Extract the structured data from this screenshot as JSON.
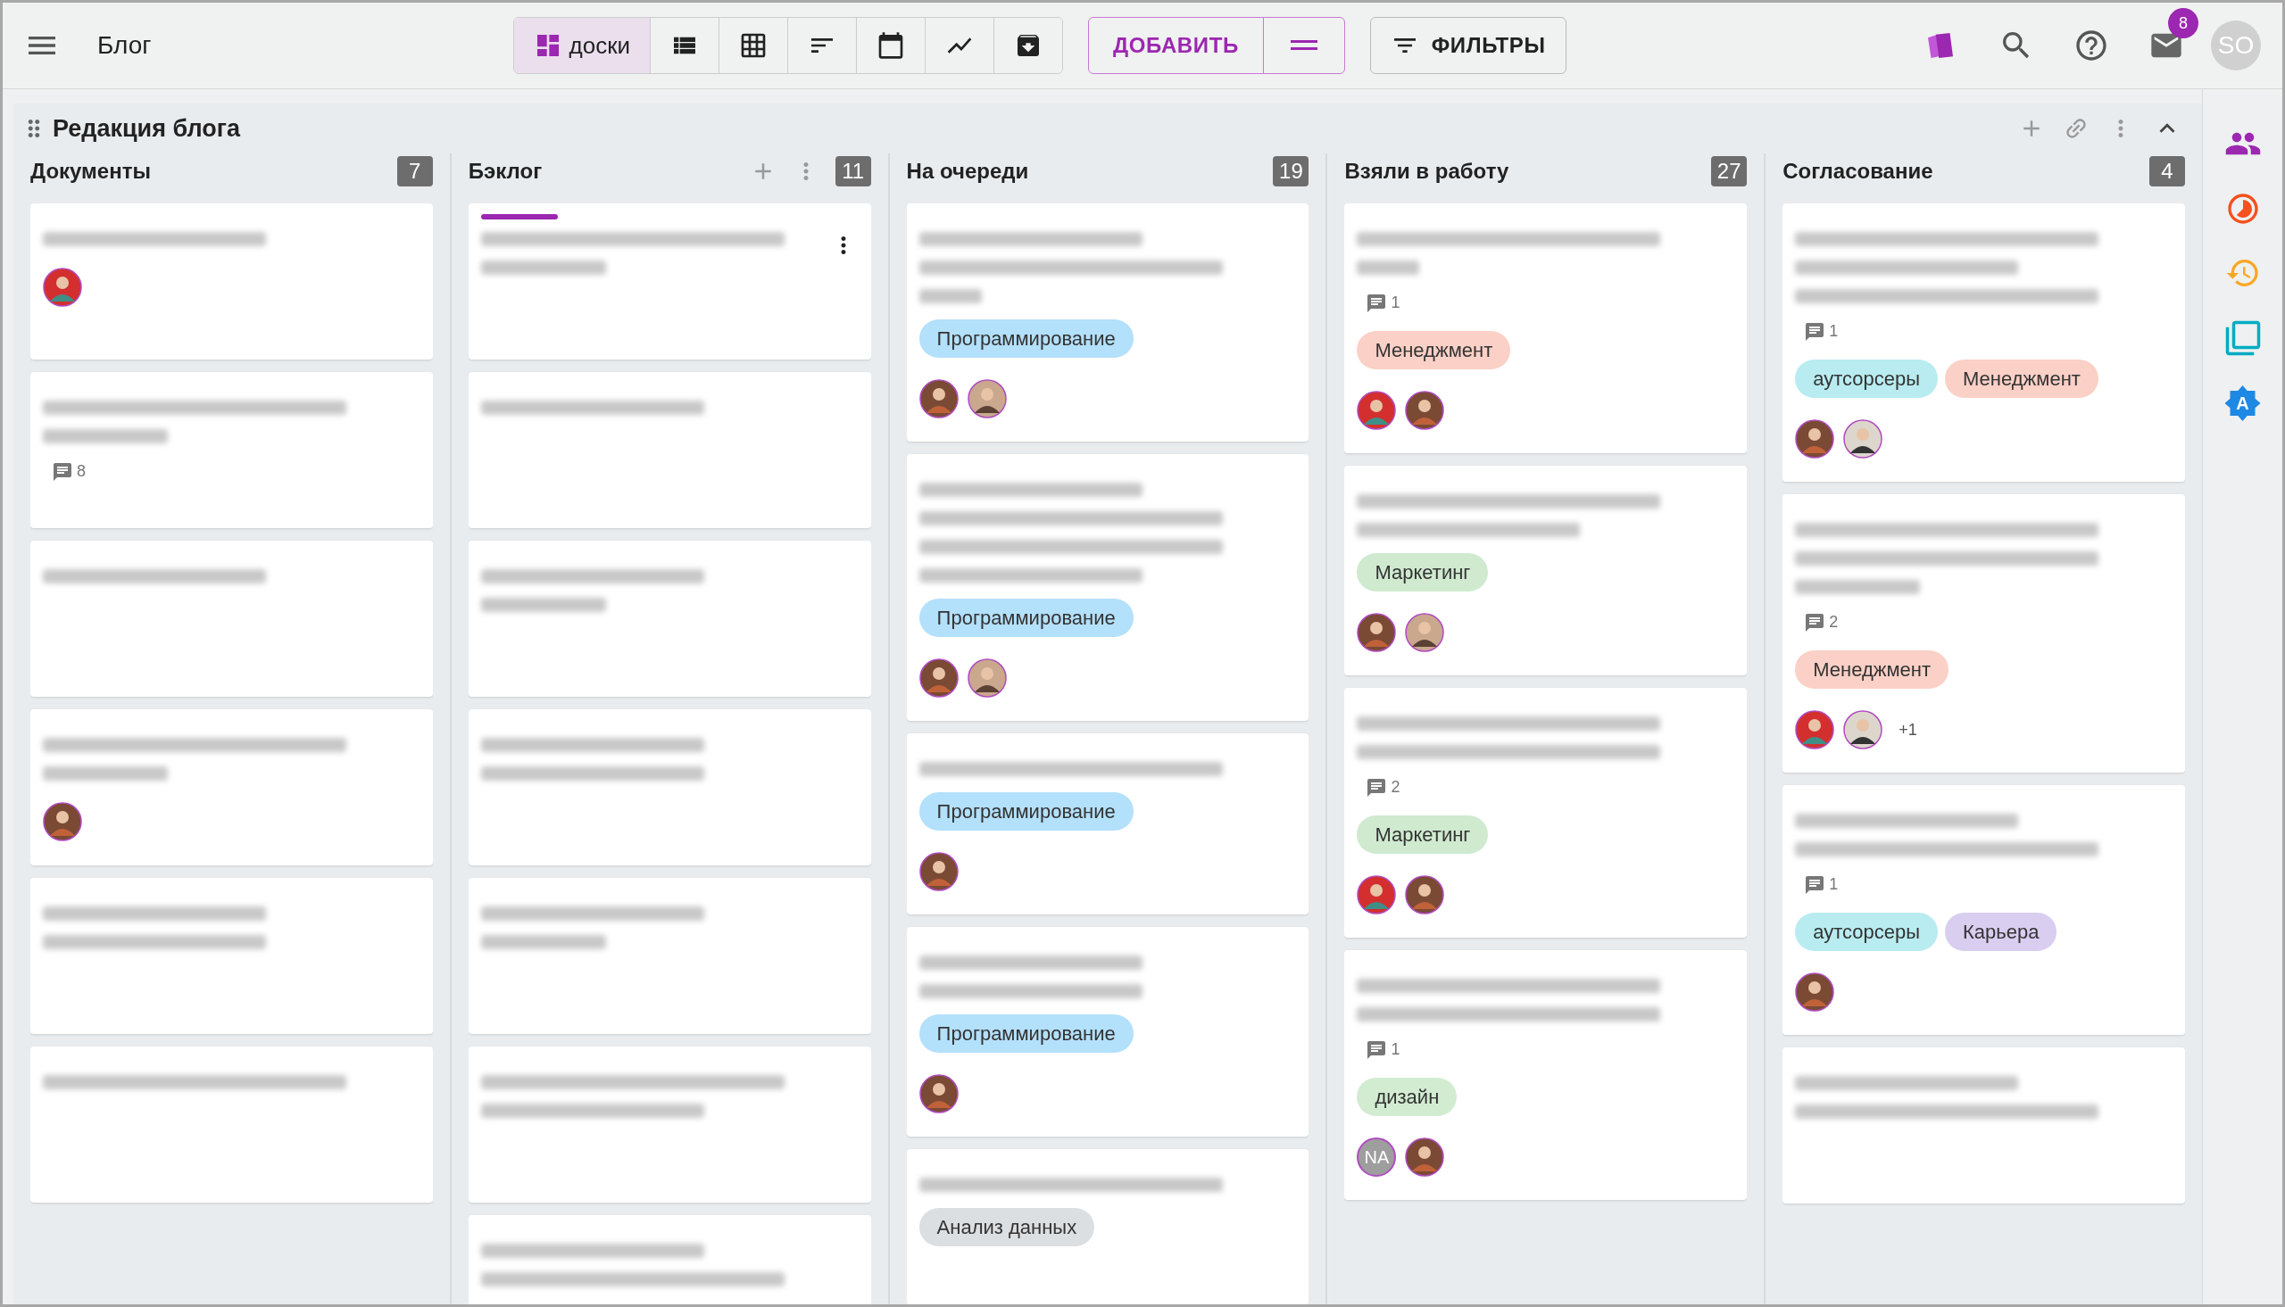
{
  "app_bar": {
    "title": "Блог",
    "views": [
      {
        "kind": "boards",
        "label": "доски",
        "selected": true
      },
      {
        "kind": "list",
        "selected": false
      },
      {
        "kind": "table",
        "selected": false
      },
      {
        "kind": "gantt",
        "selected": false
      },
      {
        "kind": "calendar",
        "selected": false
      },
      {
        "kind": "chart",
        "selected": false
      },
      {
        "kind": "archive",
        "selected": false
      }
    ],
    "add_button": "ДОБАВИТЬ",
    "filters_button": "ФИЛЬТРЫ",
    "mail_badge": "8",
    "user_initials": "SO"
  },
  "board": {
    "title": "Редакция блога",
    "columns": [
      {
        "title": "Документы",
        "count": "7",
        "cards": [
          {
            "lines": [
              {
                "kind": "medium"
              }
            ],
            "avatars": [
              {
                "kind": "red"
              }
            ]
          },
          {
            "lines": [
              {
                "kind": "long"
              },
              {
                "kind": "short"
              }
            ],
            "comments": "8"
          },
          {
            "lines": [
              {
                "kind": "medium"
              }
            ]
          },
          {
            "lines": [
              {
                "kind": "long"
              },
              {
                "kind": "short"
              }
            ],
            "avatars": [
              {
                "kind": "brown"
              }
            ]
          },
          {
            "lines": [
              {
                "kind": "medium"
              },
              {
                "kind": "medium"
              }
            ]
          },
          {
            "lines": [
              {
                "kind": "long"
              }
            ]
          }
        ]
      },
      {
        "title": "Бэклог",
        "count": "11",
        "actions": true,
        "cards": [
          {
            "progress": true,
            "menu": true,
            "lines": [
              {
                "kind": "long"
              },
              {
                "kind": "short"
              }
            ]
          },
          {
            "lines": [
              {
                "kind": "medium"
              }
            ]
          },
          {
            "lines": [
              {
                "kind": "medium"
              },
              {
                "kind": "short"
              }
            ]
          },
          {
            "lines": [
              {
                "kind": "medium"
              },
              {
                "kind": "medium"
              }
            ]
          },
          {
            "lines": [
              {
                "kind": "medium"
              },
              {
                "kind": "short"
              }
            ]
          },
          {
            "lines": [
              {
                "kind": "long"
              },
              {
                "kind": "medium"
              }
            ]
          },
          {
            "lines": [
              {
                "kind": "medium"
              },
              {
                "kind": "long"
              }
            ]
          }
        ]
      },
      {
        "title": "На очереди",
        "count": "19",
        "cards": [
          {
            "lines": [
              {
                "kind": "medium"
              },
              {
                "kind": "long"
              },
              {
                "kind": "tiny"
              }
            ],
            "tags": [
              {
                "label": "Программирование",
                "color": "#b3e0fb"
              }
            ],
            "avatars": [
              {
                "kind": "brown"
              },
              {
                "kind": "light"
              }
            ]
          },
          {
            "lines": [
              {
                "kind": "medium"
              },
              {
                "kind": "long"
              },
              {
                "kind": "long"
              },
              {
                "kind": "medium"
              }
            ],
            "tags": [
              {
                "label": "Программирование",
                "color": "#b3e0fb"
              }
            ],
            "avatars": [
              {
                "kind": "brown"
              },
              {
                "kind": "light"
              }
            ]
          },
          {
            "lines": [
              {
                "kind": "long"
              }
            ],
            "tags": [
              {
                "label": "Программирование",
                "color": "#b3e0fb"
              }
            ],
            "avatars": [
              {
                "kind": "brown"
              }
            ]
          },
          {
            "lines": [
              {
                "kind": "medium"
              },
              {
                "kind": "medium"
              }
            ],
            "tags": [
              {
                "label": "Программирование",
                "color": "#b3e0fb"
              }
            ],
            "avatars": [
              {
                "kind": "brown"
              }
            ]
          },
          {
            "lines": [
              {
                "kind": "long"
              }
            ],
            "tags": [
              {
                "label": "Анализ данных",
                "color": "#dcdfe2"
              }
            ]
          }
        ]
      },
      {
        "title": "Взяли в работу",
        "count": "27",
        "cards": [
          {
            "lines": [
              {
                "kind": "long"
              },
              {
                "kind": "tiny"
              }
            ],
            "comments": "1",
            "tags": [
              {
                "label": "Менеджмент",
                "color": "#fbd0c6"
              }
            ],
            "avatars": [
              {
                "kind": "red"
              },
              {
                "kind": "brown"
              }
            ]
          },
          {
            "lines": [
              {
                "kind": "long"
              },
              {
                "kind": "medium"
              }
            ],
            "tags": [
              {
                "label": "Маркетинг",
                "color": "#cfeacf"
              }
            ],
            "avatars": [
              {
                "kind": "brown"
              },
              {
                "kind": "light"
              }
            ]
          },
          {
            "lines": [
              {
                "kind": "long"
              },
              {
                "kind": "long"
              }
            ],
            "comments": "2",
            "tags": [
              {
                "label": "Маркетинг",
                "color": "#cfeacf"
              }
            ],
            "avatars": [
              {
                "kind": "red"
              },
              {
                "kind": "brown"
              }
            ]
          },
          {
            "lines": [
              {
                "kind": "long"
              },
              {
                "kind": "long"
              }
            ],
            "comments": "1",
            "tags": [
              {
                "label": "дизайн",
                "color": "#d2ecd2"
              }
            ],
            "avatars": [
              {
                "kind": "initials",
                "text": "NA"
              },
              {
                "kind": "brown"
              }
            ]
          }
        ]
      },
      {
        "title": "Согласование",
        "count": "4",
        "cards": [
          {
            "lines": [
              {
                "kind": "long"
              },
              {
                "kind": "medium"
              },
              {
                "kind": "long"
              }
            ],
            "comments": "1",
            "tags": [
              {
                "label": "аутсорсеры",
                "color": "#b8ecf0"
              },
              {
                "label": "Менеджмент",
                "color": "#fbd0c6"
              }
            ],
            "avatars": [
              {
                "kind": "brown"
              },
              {
                "kind": "blonde"
              }
            ]
          },
          {
            "lines": [
              {
                "kind": "long"
              },
              {
                "kind": "long"
              },
              {
                "kind": "short"
              }
            ],
            "comments": "2",
            "tags": [
              {
                "label": "Менеджмент",
                "color": "#fbd0c6"
              }
            ],
            "avatars": [
              {
                "kind": "red"
              },
              {
                "kind": "blonde"
              },
              {
                "kind": "more",
                "text": "+1"
              }
            ]
          },
          {
            "lines": [
              {
                "kind": "medium"
              },
              {
                "kind": "long"
              }
            ],
            "comments": "1",
            "tags": [
              {
                "label": "аутсорсеры",
                "color": "#b8ecf0"
              },
              {
                "label": "Карьера",
                "color": "#d9cdf0"
              }
            ],
            "avatars": [
              {
                "kind": "brown"
              }
            ]
          },
          {
            "lines": [
              {
                "kind": "medium"
              },
              {
                "kind": "long"
              }
            ]
          }
        ]
      }
    ]
  },
  "side_bar": [
    {
      "kind": "people",
      "selected": true
    },
    {
      "kind": "timer",
      "selected": false
    },
    {
      "kind": "history",
      "selected": false
    },
    {
      "kind": "copy",
      "selected": false
    },
    {
      "kind": "badge",
      "letter": "A",
      "selected": false
    }
  ]
}
